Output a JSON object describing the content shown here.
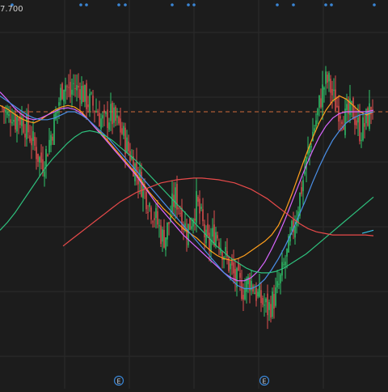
{
  "price_label": "7.700",
  "event_markers": [
    "E",
    "E"
  ],
  "colors": {
    "background": "#1c1c1c",
    "grid": "#2b2b2b",
    "up": "#2fc46a",
    "down": "#e05050",
    "ref_line": "#d06a3a",
    "marker_dot": "#3a86d6",
    "ma": [
      "#ff9f1c",
      "#d966ff",
      "#4a8fe7",
      "#2ec27e",
      "#e84a4a",
      "#34c3e8"
    ]
  },
  "chart_data": {
    "type": "candlestick",
    "title": "",
    "x": [],
    "ylim": [
      4.5,
      8.5
    ],
    "reference_line": 7.7,
    "grid": true,
    "candles_close_path": [
      7.75,
      7.7,
      7.6,
      7.72,
      7.58,
      7.64,
      7.62,
      7.55,
      7.5,
      7.4,
      7.3,
      7.2,
      7.1,
      7.05,
      7.15,
      7.3,
      7.45,
      7.6,
      7.78,
      7.95,
      8.1,
      8.0,
      7.9,
      8.05,
      7.98,
      8.02,
      7.95,
      7.85,
      7.82,
      7.8,
      7.75,
      7.68,
      7.6,
      7.55,
      7.62,
      7.66,
      7.6,
      7.55,
      7.5,
      7.42,
      7.3,
      7.2,
      7.1,
      7.0,
      6.9,
      6.8,
      6.7,
      6.6,
      6.5,
      6.42,
      6.32,
      6.2,
      6.1,
      6.15,
      6.3,
      6.5,
      6.62,
      6.55,
      6.4,
      6.25,
      6.2,
      6.3,
      6.45,
      6.55,
      6.4,
      6.25,
      6.05,
      6.0,
      6.1,
      6.2,
      6.12,
      6.0,
      5.9,
      5.8,
      5.72,
      5.62,
      5.55,
      5.5,
      5.45,
      5.5,
      5.58,
      5.52,
      5.42,
      5.35,
      5.3,
      5.25,
      5.2,
      5.26,
      5.33,
      5.42,
      5.55,
      5.7,
      5.85,
      6.0,
      6.2,
      6.35,
      6.55,
      6.75,
      6.95,
      7.15,
      7.35,
      7.5,
      7.65,
      7.85,
      8.0,
      8.1,
      8.05,
      7.9,
      7.8,
      7.75,
      7.7,
      7.6,
      7.65,
      7.72,
      7.68,
      7.55,
      7.45,
      7.5,
      7.6,
      7.7,
      7.78
    ],
    "moving_averages": [
      {
        "path": [
          7.78,
          7.74,
          7.68,
          7.62,
          7.58,
          7.56,
          7.6,
          7.66,
          7.72,
          7.76,
          7.78,
          7.76,
          7.7,
          7.6,
          7.5,
          7.42,
          7.32,
          7.22,
          7.12,
          7.02,
          6.92,
          6.8,
          6.68,
          6.58,
          6.48,
          6.4,
          6.3,
          6.22,
          6.16,
          6.1,
          6.02,
          5.94,
          5.88,
          5.84,
          5.82,
          5.84,
          5.88,
          5.94,
          6.0,
          6.06,
          6.14,
          6.26,
          6.44,
          6.66,
          6.9,
          7.14,
          7.36,
          7.56,
          7.72,
          7.84,
          7.9,
          7.86,
          7.78,
          7.7,
          7.66,
          7.7
        ]
      },
      {
        "path": [
          7.95,
          7.86,
          7.76,
          7.68,
          7.62,
          7.6,
          7.62,
          7.66,
          7.7,
          7.74,
          7.75,
          7.73,
          7.68,
          7.6,
          7.5,
          7.4,
          7.3,
          7.2,
          7.1,
          7.0,
          6.9,
          6.78,
          6.66,
          6.54,
          6.44,
          6.34,
          6.24,
          6.14,
          6.06,
          5.98,
          5.9,
          5.82,
          5.74,
          5.66,
          5.6,
          5.56,
          5.56,
          5.6,
          5.68,
          5.8,
          5.96,
          6.14,
          6.34,
          6.56,
          6.78,
          7.0,
          7.2,
          7.38,
          7.52,
          7.62,
          7.68,
          7.7,
          7.7,
          7.7,
          7.7,
          7.72
        ]
      },
      {
        "path": [
          7.9,
          7.84,
          7.78,
          7.72,
          7.66,
          7.62,
          7.6,
          7.6,
          7.62,
          7.66,
          7.7,
          7.7,
          7.66,
          7.6,
          7.52,
          7.44,
          7.36,
          7.26,
          7.16,
          7.06,
          6.96,
          6.86,
          6.76,
          6.66,
          6.56,
          6.46,
          6.36,
          6.26,
          6.16,
          6.06,
          5.96,
          5.86,
          5.76,
          5.66,
          5.58,
          5.5,
          5.46,
          5.46,
          5.5,
          5.58,
          5.7,
          5.84,
          6.0,
          6.18,
          6.38,
          6.58,
          6.8,
          7.0,
          7.18,
          7.34,
          7.46,
          7.56,
          7.62,
          7.66,
          7.68,
          7.7
        ]
      },
      {
        "path": [
          6.2,
          6.3,
          6.42,
          6.56,
          6.7,
          6.84,
          6.98,
          7.1,
          7.2,
          7.3,
          7.38,
          7.44,
          7.46,
          7.44,
          7.4,
          7.34,
          7.26,
          7.18,
          7.1,
          7.0,
          6.9,
          6.8,
          6.7,
          6.6,
          6.5,
          6.4,
          6.3,
          6.2,
          6.1,
          6.0,
          5.92,
          5.84,
          5.78,
          5.72,
          5.68,
          5.66,
          5.66,
          5.68,
          5.72,
          5.78,
          5.84,
          5.9,
          5.98,
          6.06,
          6.14,
          6.22,
          6.3,
          6.38,
          6.46,
          6.54,
          6.62
        ]
      },
      {
        "path": [
          6.0,
          6.08,
          6.16,
          6.24,
          6.32,
          6.4,
          6.48,
          6.56,
          6.62,
          6.68,
          6.72,
          6.76,
          6.8,
          6.82,
          6.84,
          6.85,
          6.86,
          6.86,
          6.85,
          6.84,
          6.82,
          6.8,
          6.76,
          6.72,
          6.66,
          6.6,
          6.52,
          6.44,
          6.36,
          6.28,
          6.22,
          6.18,
          6.16,
          6.14,
          6.14,
          6.14,
          6.14,
          6.14,
          6.13
        ]
      },
      {
        "path": [
          6.16,
          6.18,
          6.2
        ]
      }
    ]
  }
}
